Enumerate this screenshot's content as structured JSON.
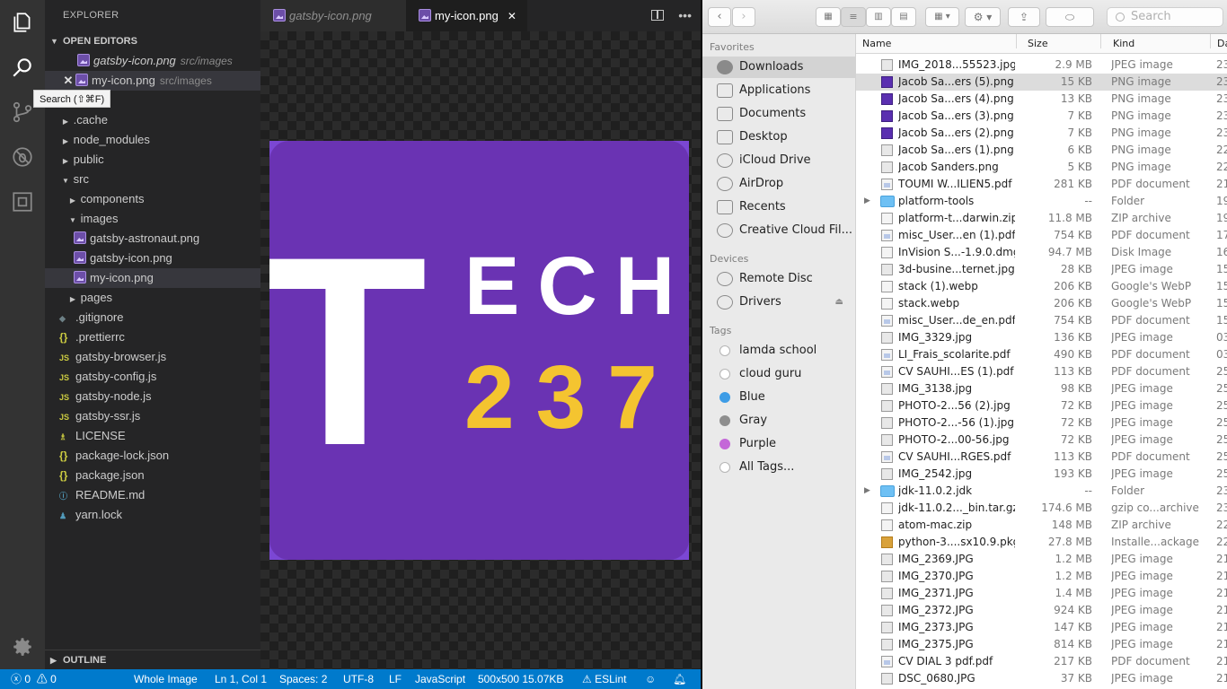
{
  "vscode": {
    "tooltip": "Search (⇧⌘F)",
    "explorer_title": "EXPLORER",
    "open_editors_label": "OPEN EDITORS",
    "open_editors": [
      {
        "name": "gatsby-icon.png",
        "path": "src/images"
      },
      {
        "name": "my-icon.png",
        "path": "src/images"
      }
    ],
    "tree": [
      {
        "label": ".cache",
        "type": "folder"
      },
      {
        "label": "node_modules",
        "type": "folder"
      },
      {
        "label": "public",
        "type": "folder"
      },
      {
        "label": "src",
        "type": "folder-open"
      },
      {
        "label": "components",
        "type": "folder"
      },
      {
        "label": "images",
        "type": "folder-open"
      },
      {
        "label": "gatsby-astronaut.png",
        "type": "image"
      },
      {
        "label": "gatsby-icon.png",
        "type": "image"
      },
      {
        "label": "my-icon.png",
        "type": "image"
      },
      {
        "label": "pages",
        "type": "folder"
      },
      {
        "label": ".gitignore",
        "type": "git"
      },
      {
        "label": ".prettierrc",
        "type": "json"
      },
      {
        "label": "gatsby-browser.js",
        "type": "js"
      },
      {
        "label": "gatsby-config.js",
        "type": "js"
      },
      {
        "label": "gatsby-node.js",
        "type": "js"
      },
      {
        "label": "gatsby-ssr.js",
        "type": "js"
      },
      {
        "label": "LICENSE",
        "type": "license"
      },
      {
        "label": "package-lock.json",
        "type": "json"
      },
      {
        "label": "package.json",
        "type": "json"
      },
      {
        "label": "README.md",
        "type": "info"
      },
      {
        "label": "yarn.lock",
        "type": "yarn"
      }
    ],
    "outline_label": "OUTLINE",
    "tabs": [
      "gatsby-icon.png",
      "my-icon.png"
    ],
    "preview": {
      "letter": "T",
      "line1": "ECH",
      "line2": "237",
      "bg": "#6a33b3",
      "accent": "#f4c430"
    },
    "status": {
      "errors": "0",
      "warnings": "0",
      "scope": "Whole Image",
      "position": "Ln 1, Col 1",
      "spaces": "Spaces: 2",
      "encoding": "UTF-8",
      "eol": "LF",
      "language": "JavaScript",
      "image_info": "500x500 15.07KB",
      "eslint": "ESLint"
    }
  },
  "finder": {
    "search_placeholder": "Search",
    "favorites_label": "Favorites",
    "favorites": [
      "Downloads",
      "Applications",
      "Documents",
      "Desktop",
      "iCloud Drive",
      "AirDrop",
      "Recents",
      "Creative Cloud Fil..."
    ],
    "devices_label": "Devices",
    "devices": [
      "Remote Disc",
      "Drivers"
    ],
    "tags_label": "Tags",
    "tags": [
      {
        "name": "lamda school",
        "color": "#ffffff"
      },
      {
        "name": "cloud guru",
        "color": "#ffffff"
      },
      {
        "name": "Blue",
        "color": "#3d9ce6"
      },
      {
        "name": "Gray",
        "color": "#8e8e8e"
      },
      {
        "name": "Purple",
        "color": "#c467d8"
      },
      {
        "name": "All Tags...",
        "color": "#ffffff"
      }
    ],
    "columns": {
      "name": "Name",
      "size": "Size",
      "kind": "Kind",
      "date": "Da"
    },
    "files": [
      {
        "name": "IMG_2018...55523.jpg",
        "size": "2.9 MB",
        "kind": "JPEG image",
        "date": "23",
        "icon": "img"
      },
      {
        "name": "Jacob Sa...ers (5).png",
        "size": "15 KB",
        "kind": "PNG image",
        "date": "23",
        "icon": "png"
      },
      {
        "name": "Jacob Sa...ers (4).png",
        "size": "13 KB",
        "kind": "PNG image",
        "date": "23",
        "icon": "png"
      },
      {
        "name": "Jacob Sa...ers (3).png",
        "size": "7 KB",
        "kind": "PNG image",
        "date": "23",
        "icon": "png"
      },
      {
        "name": "Jacob Sa...ers (2).png",
        "size": "7 KB",
        "kind": "PNG image",
        "date": "23",
        "icon": "png"
      },
      {
        "name": "Jacob Sa...ers (1).png",
        "size": "6 KB",
        "kind": "PNG image",
        "date": "22",
        "icon": "img"
      },
      {
        "name": "Jacob Sanders.png",
        "size": "5 KB",
        "kind": "PNG image",
        "date": "22",
        "icon": "img"
      },
      {
        "name": "TOUMI W...ILIEN5.pdf",
        "size": "281 KB",
        "kind": "PDF document",
        "date": "21",
        "icon": "pdf"
      },
      {
        "name": "platform-tools",
        "size": "--",
        "kind": "Folder",
        "date": "19",
        "icon": "folder"
      },
      {
        "name": "platform-t...darwin.zip",
        "size": "11.8 MB",
        "kind": "ZIP archive",
        "date": "19",
        "icon": "doc"
      },
      {
        "name": "misc_User...en (1).pdf",
        "size": "754 KB",
        "kind": "PDF document",
        "date": "17",
        "icon": "pdf"
      },
      {
        "name": "InVision S...-1.9.0.dmg",
        "size": "94.7 MB",
        "kind": "Disk Image",
        "date": "16",
        "icon": "doc"
      },
      {
        "name": "3d-busine...ternet.jpg",
        "size": "28 KB",
        "kind": "JPEG image",
        "date": "15",
        "icon": "img"
      },
      {
        "name": "stack (1).webp",
        "size": "206 KB",
        "kind": "Google's WebP",
        "date": "15",
        "icon": "doc"
      },
      {
        "name": "stack.webp",
        "size": "206 KB",
        "kind": "Google's WebP",
        "date": "15",
        "icon": "doc"
      },
      {
        "name": "misc_User...de_en.pdf",
        "size": "754 KB",
        "kind": "PDF document",
        "date": "15",
        "icon": "pdf"
      },
      {
        "name": "IMG_3329.jpg",
        "size": "136 KB",
        "kind": "JPEG image",
        "date": "03",
        "icon": "img"
      },
      {
        "name": "LI_Frais_scolarite.pdf",
        "size": "490 KB",
        "kind": "PDF document",
        "date": "03",
        "icon": "pdf"
      },
      {
        "name": "CV SAUHI...ES (1).pdf",
        "size": "113 KB",
        "kind": "PDF document",
        "date": "25",
        "icon": "pdf"
      },
      {
        "name": "IMG_3138.jpg",
        "size": "98 KB",
        "kind": "JPEG image",
        "date": "25",
        "icon": "img"
      },
      {
        "name": "PHOTO-2...56 (2).jpg",
        "size": "72 KB",
        "kind": "JPEG image",
        "date": "25",
        "icon": "img"
      },
      {
        "name": "PHOTO-2...-56 (1).jpg",
        "size": "72 KB",
        "kind": "JPEG image",
        "date": "25",
        "icon": "img"
      },
      {
        "name": "PHOTO-2...00-56.jpg",
        "size": "72 KB",
        "kind": "JPEG image",
        "date": "25",
        "icon": "img"
      },
      {
        "name": "CV SAUHI...RGES.pdf",
        "size": "113 KB",
        "kind": "PDF document",
        "date": "25",
        "icon": "pdf"
      },
      {
        "name": "IMG_2542.jpg",
        "size": "193 KB",
        "kind": "JPEG image",
        "date": "25",
        "icon": "img"
      },
      {
        "name": "jdk-11.0.2.jdk",
        "size": "--",
        "kind": "Folder",
        "date": "23",
        "icon": "folder"
      },
      {
        "name": "jdk-11.0.2..._bin.tar.gz",
        "size": "174.6 MB",
        "kind": "gzip co...archive",
        "date": "23",
        "icon": "doc"
      },
      {
        "name": "atom-mac.zip",
        "size": "148 MB",
        "kind": "ZIP archive",
        "date": "22",
        "icon": "doc"
      },
      {
        "name": "python-3....sx10.9.pkg",
        "size": "27.8 MB",
        "kind": "Installe...ackage",
        "date": "22",
        "icon": "pkg"
      },
      {
        "name": "IMG_2369.JPG",
        "size": "1.2 MB",
        "kind": "JPEG image",
        "date": "21",
        "icon": "img"
      },
      {
        "name": "IMG_2370.JPG",
        "size": "1.2 MB",
        "kind": "JPEG image",
        "date": "21",
        "icon": "img"
      },
      {
        "name": "IMG_2371.JPG",
        "size": "1.4 MB",
        "kind": "JPEG image",
        "date": "21",
        "icon": "img"
      },
      {
        "name": "IMG_2372.JPG",
        "size": "924 KB",
        "kind": "JPEG image",
        "date": "21",
        "icon": "img"
      },
      {
        "name": "IMG_2373.JPG",
        "size": "147 KB",
        "kind": "JPEG image",
        "date": "21",
        "icon": "img"
      },
      {
        "name": "IMG_2375.JPG",
        "size": "814 KB",
        "kind": "JPEG image",
        "date": "21",
        "icon": "img"
      },
      {
        "name": "CV DIAL 3 pdf.pdf",
        "size": "217 KB",
        "kind": "PDF document",
        "date": "21",
        "icon": "pdf"
      },
      {
        "name": "DSC_0680.JPG",
        "size": "37 KB",
        "kind": "JPEG image",
        "date": "21",
        "icon": "img"
      }
    ]
  }
}
